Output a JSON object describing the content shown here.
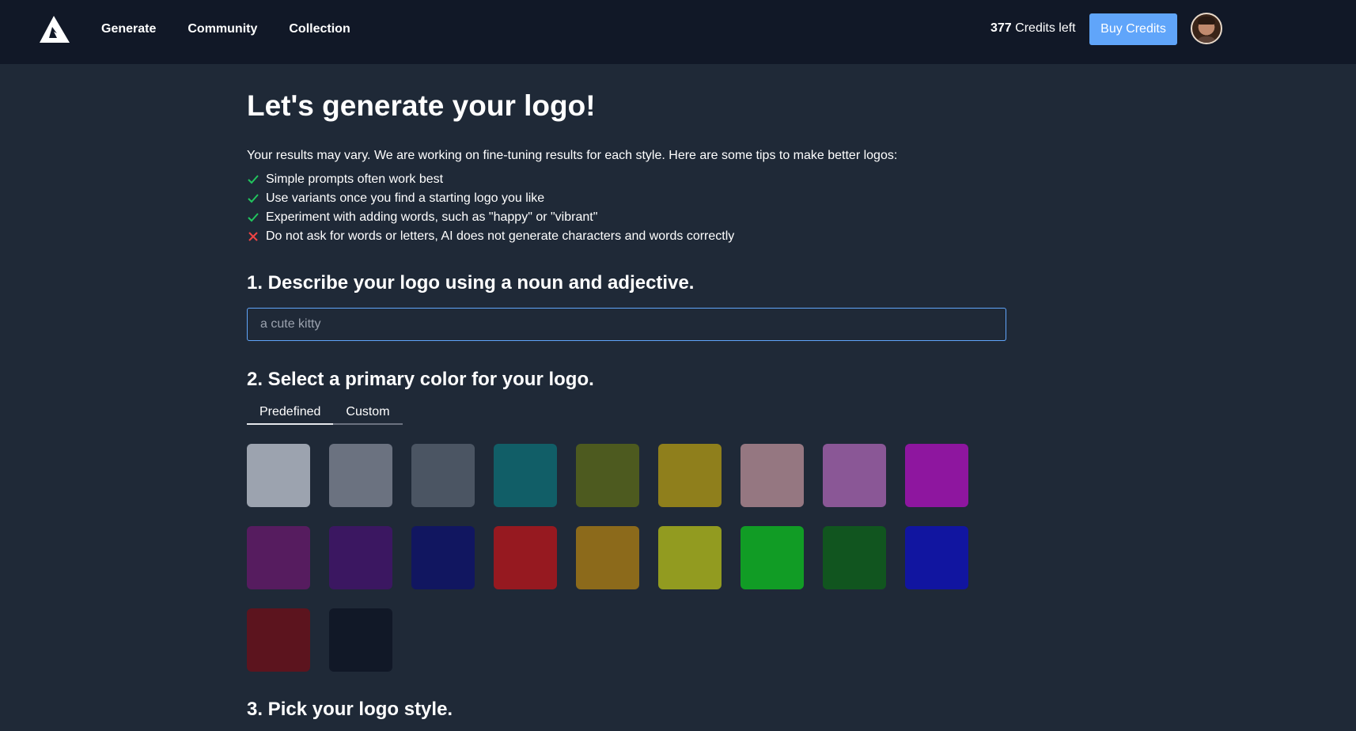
{
  "nav": {
    "links": [
      "Generate",
      "Community",
      "Collection"
    ],
    "credits_count": "377",
    "credits_suffix": "Credits left",
    "buy_label": "Buy Credits"
  },
  "main": {
    "title": "Let's generate your logo!",
    "intro": "Your results may vary. We are working on fine-tuning results for each style. Here are some tips to make better logos:",
    "tips": [
      {
        "type": "do",
        "text": "Simple prompts often work best"
      },
      {
        "type": "do",
        "text": "Use variants once you find a starting logo you like"
      },
      {
        "type": "do",
        "text": "Experiment with adding words, such as \"happy\" or \"vibrant\""
      },
      {
        "type": "dont",
        "text": "Do not ask for words or letters, AI does not generate characters and words correctly"
      }
    ],
    "step1": "1. Describe your logo using a noun and adjective.",
    "input_placeholder": "a cute kitty",
    "step2": "2. Select a primary color for your logo.",
    "tabs": [
      "Predefined",
      "Custom"
    ],
    "active_tab": "Predefined",
    "step3": "3. Pick your logo style."
  },
  "colors": {
    "check": "#22c55e",
    "cross": "#ef4444",
    "swatches": [
      "#9ca3af",
      "#6b7280",
      "#4b5563",
      "#115e67",
      "#4d5a1f",
      "#8f7f1c",
      "#957781",
      "#8a5796",
      "#8e169f",
      "#561c5f",
      "#3b1761",
      "#111660",
      "#961920",
      "#8c6a1b",
      "#929b20",
      "#119c25",
      "#11551f",
      "#1115a0",
      "#5c141e",
      "#111827"
    ]
  }
}
